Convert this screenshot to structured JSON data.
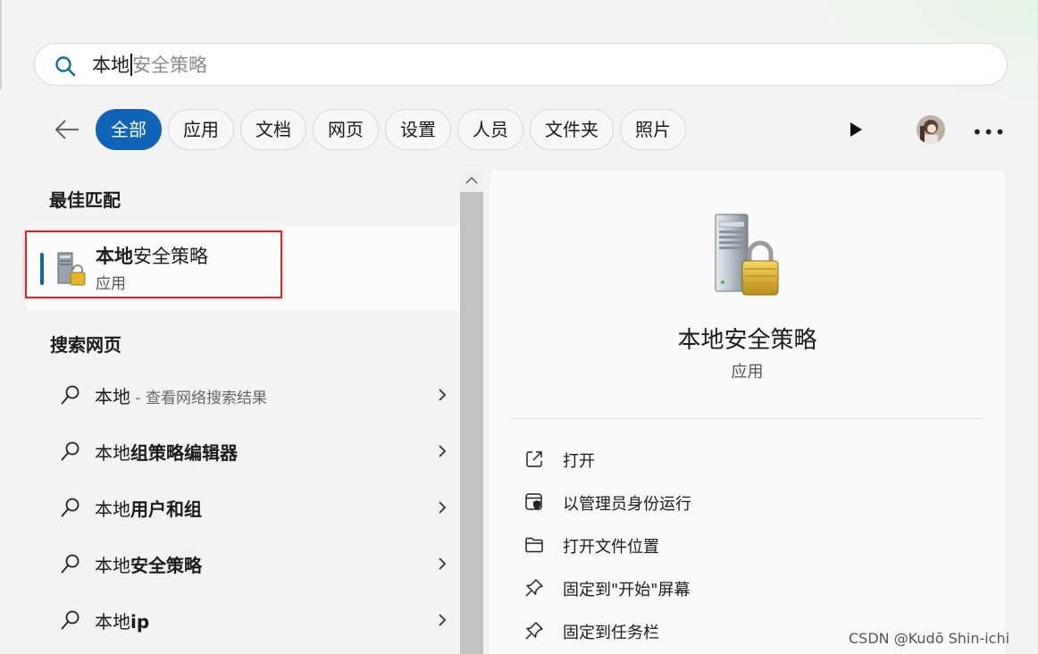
{
  "search": {
    "typed": "本地",
    "suggestion": "安全策略"
  },
  "filters": [
    "全部",
    "应用",
    "文档",
    "网页",
    "设置",
    "人员",
    "文件夹",
    "照片"
  ],
  "best_match": {
    "heading": "最佳匹配",
    "title_bold": "本地",
    "title_rest": "安全策略",
    "type": "应用"
  },
  "web": {
    "heading": "搜索网页",
    "items": [
      {
        "prefix": "本地",
        "bold": "",
        "hint": " - 查看网络搜索结果"
      },
      {
        "prefix": "本地",
        "bold": "组策略编辑器",
        "hint": ""
      },
      {
        "prefix": "本地",
        "bold": "用户和组",
        "hint": ""
      },
      {
        "prefix": "本地",
        "bold": "安全策略",
        "hint": ""
      },
      {
        "prefix": "本地",
        "bold": "ip",
        "hint": ""
      }
    ]
  },
  "detail": {
    "title": "本地安全策略",
    "type": "应用",
    "actions": [
      {
        "label": "打开",
        "icon": "open-external-icon"
      },
      {
        "label": "以管理员身份运行",
        "icon": "shield-admin-icon"
      },
      {
        "label": "打开文件位置",
        "icon": "folder-icon"
      },
      {
        "label": "固定到\"开始\"屏幕",
        "icon": "pin-icon"
      },
      {
        "label": "固定到任务栏",
        "icon": "pin-icon"
      }
    ]
  },
  "watermark": "CSDN @Kudō Shin-ichi",
  "colors": {
    "accent": "#0f64b8",
    "highlight_box": "#d62a2a",
    "search_icon": "#0d6ea0"
  }
}
